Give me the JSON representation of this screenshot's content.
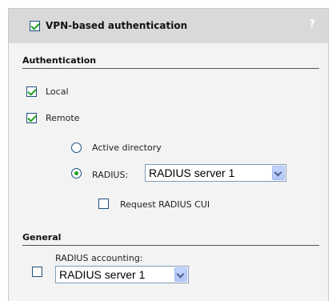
{
  "header": {
    "title": "VPN-based authentication",
    "help": "?"
  },
  "authentication": {
    "section_title": "Authentication",
    "local_label": "Local",
    "remote_label": "Remote",
    "active_directory_label": "Active directory",
    "radius_label": "RADIUS:",
    "radius_server_value": "RADIUS server 1",
    "request_cui_label": "Request RADIUS CUI"
  },
  "general": {
    "section_title": "General",
    "accounting_label": "RADIUS accounting:",
    "accounting_server_value": "RADIUS server 1"
  },
  "state": {
    "vpn_auth_checked": true,
    "local_checked": true,
    "remote_checked": true,
    "auth_method": "RADIUS",
    "request_cui_checked": false,
    "accounting_checked": false
  },
  "colors": {
    "header_bg": "#d9d9d9",
    "panel_bg": "#f3f3f3",
    "check_green": "#21a121"
  }
}
